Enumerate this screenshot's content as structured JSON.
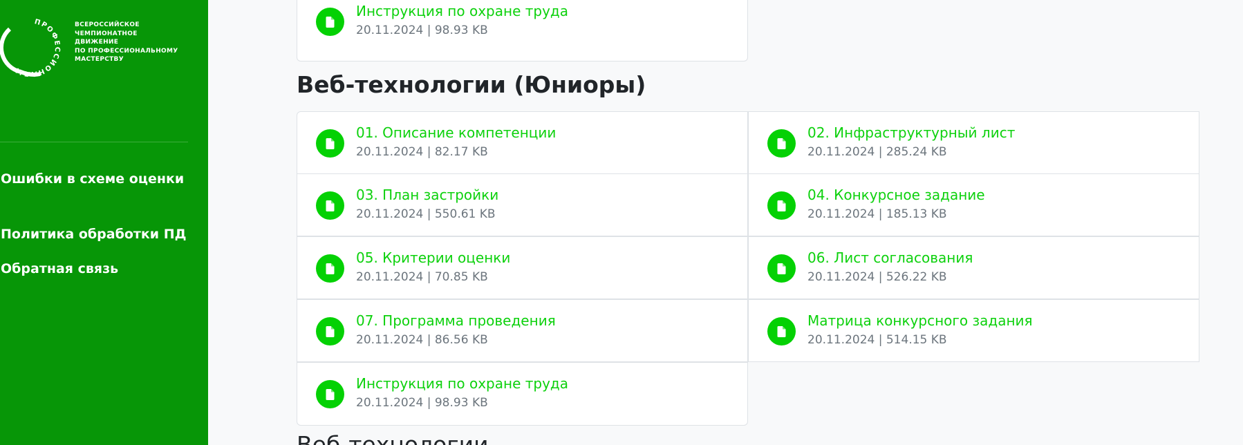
{
  "brand": {
    "logo_ring_text": "ПРОФЕССИОНАЛЫ",
    "caption_lines": [
      "Всероссийское",
      "чемпионатное",
      "движение",
      "по профессиональному",
      "мастерству"
    ],
    "colors": {
      "sidebar": "#079607",
      "accent": "#04d104",
      "link": "#0dd10d"
    }
  },
  "sidebar": {
    "links": [
      {
        "label": "Ошибки в схеме оценки"
      },
      {
        "label": "Политика обработки ПД"
      },
      {
        "label": "Обратная связь"
      }
    ]
  },
  "main": {
    "top_file": {
      "title": "Инструкция по охране труда",
      "meta": "20.11.2024 | 98.93 KB"
    },
    "section": {
      "title": "Веб-технологии (Юниоры)",
      "files": [
        {
          "title": "01. Описание компетенции",
          "meta": "20.11.2024 | 82.17 KB"
        },
        {
          "title": "02. Инфраструктурный лист",
          "meta": "20.11.2024 | 285.24 KB"
        },
        {
          "title": "03. План застройки",
          "meta": "20.11.2024 | 550.61 KB"
        },
        {
          "title": "04. Конкурсное задание",
          "meta": "20.11.2024 | 185.13 KB"
        },
        {
          "title": "05. Критерии оценки",
          "meta": "20.11.2024 | 70.85 KB"
        },
        {
          "title": "06. Лист согласования",
          "meta": "20.11.2024 | 526.22 KB"
        },
        {
          "title": "07. Программа проведения",
          "meta": "20.11.2024 | 86.56 KB"
        },
        {
          "title": "Матрица конкурсного задания",
          "meta": "20.11.2024 | 514.15 KB"
        },
        {
          "title": "Инструкция по охране труда",
          "meta": "20.11.2024 | 98.93 KB"
        }
      ],
      "file_icon": "file-icon"
    },
    "next_section_title": "Веб-технологии"
  }
}
